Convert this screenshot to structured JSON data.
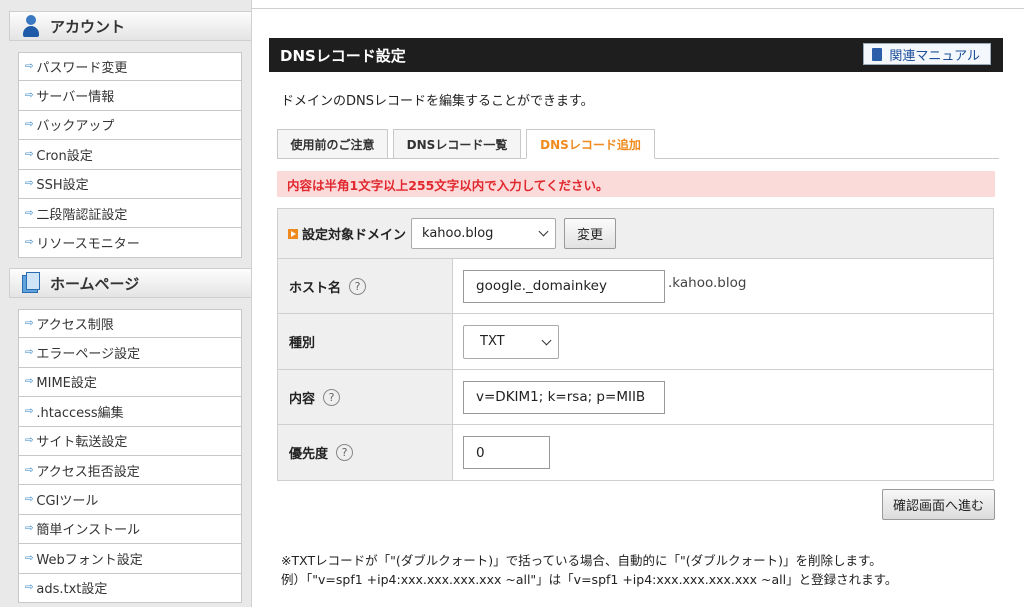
{
  "sidebar": {
    "account": {
      "heading": "アカウント",
      "items": [
        "パスワード変更",
        "サーバー情報",
        "バックアップ",
        "Cron設定",
        "SSH設定",
        "二段階認証設定",
        "リソースモニター"
      ]
    },
    "homepage": {
      "heading": "ホームページ",
      "items": [
        "アクセス制限",
        "エラーページ設定",
        "MIME設定",
        ".htaccess編集",
        "サイト転送設定",
        "アクセス拒否設定",
        "CGIツール",
        "簡単インストール",
        "Webフォント設定",
        "ads.txt設定"
      ]
    }
  },
  "main": {
    "title": "DNSレコード設定",
    "manual_button": "関連マニュアル",
    "description": "ドメインのDNSレコードを編集することができます。",
    "tabs": [
      "使用前のご注意",
      "DNSレコード一覧",
      "DNSレコード追加"
    ],
    "active_tab": "DNSレコード追加",
    "error": "内容は半角1文字以上255文字以内で入力してください。",
    "domain": {
      "label": "設定対象ドメイン",
      "selected": "kahoo.blog",
      "change_button": "変更"
    },
    "host": {
      "label": "ホスト名",
      "value": "google._domainkey",
      "suffix": ".kahoo.blog"
    },
    "type": {
      "label": "種別",
      "selected": "TXT"
    },
    "content": {
      "label": "内容",
      "value": "v=DKIM1; k=rsa; p=MIIB"
    },
    "priority": {
      "label": "優先度",
      "value": "0"
    },
    "help_mark": "?",
    "confirm_button": "確認画面へ進む",
    "note_line1": "※TXTレコードが「\"(ダブルクォート)」で括っている場合、自動的に「\"(ダブルクォート)」を削除します。",
    "note_line2": "例）「\"v=spf1 +ip4:xxx.xxx.xxx.xxx ~all\"」は「v=spf1 +ip4:xxx.xxx.xxx.xxx ~all」と登録されます。"
  }
}
